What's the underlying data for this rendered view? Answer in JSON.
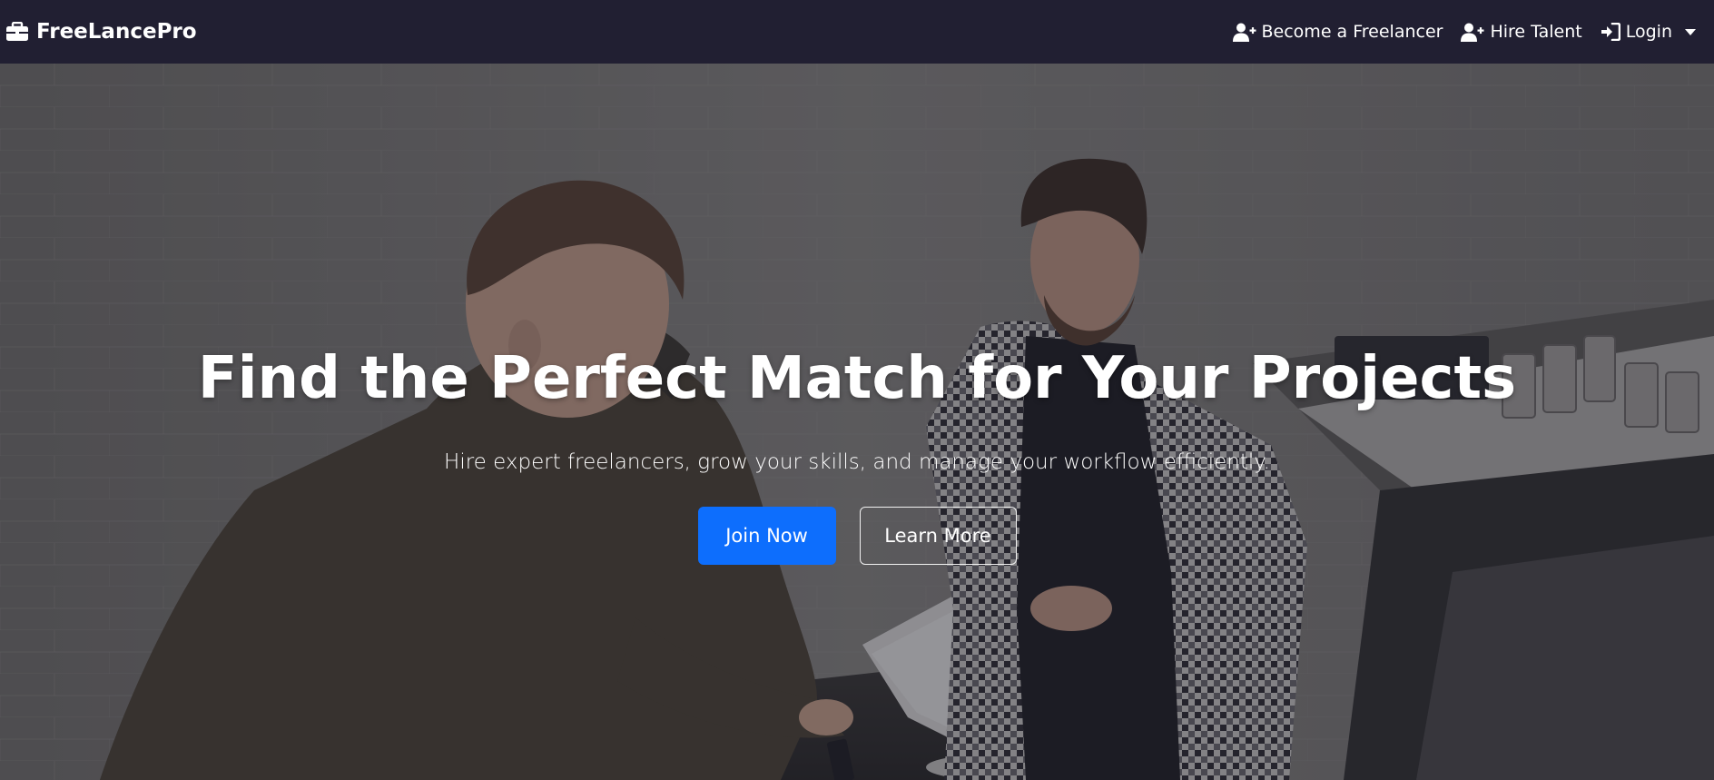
{
  "navbar": {
    "brand": "FreeLancePro",
    "brand_icon": "briefcase-icon",
    "links": [
      {
        "label": "Become a Freelancer",
        "icon": "user-plus-icon"
      },
      {
        "label": "Hire Talent",
        "icon": "user-plus-icon"
      },
      {
        "label": "Login",
        "icon": "sign-in-icon",
        "dropdown": true
      }
    ]
  },
  "hero": {
    "title": "Find the Perfect Match for Your Projects",
    "subtitle": "Hire expert freelancers, grow your skills, and manage your workflow efficiently.",
    "primary_button": "Join Now",
    "secondary_button": "Learn More",
    "background_image": "hero-photo"
  },
  "colors": {
    "navbar_bg": "#211f32",
    "primary": "#0d6efd",
    "text": "#ffffff"
  }
}
